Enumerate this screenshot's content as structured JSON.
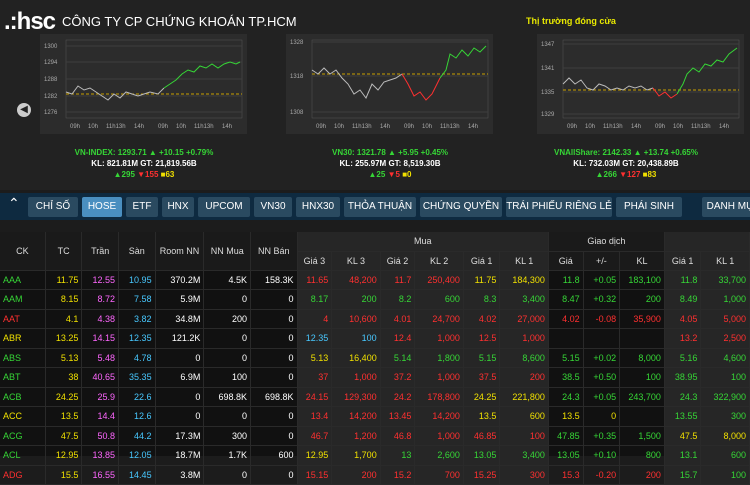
{
  "header": {
    "logo": ".:hsc",
    "company": "CÔNG TY CP CHỨNG KHOÁN TP.HCM",
    "market_status": "Thị trường đóng cửa"
  },
  "charts": [
    {
      "yticks": [
        "1300",
        "1294",
        "1288",
        "1282",
        "1276"
      ],
      "ref_label": "1282",
      "xticks": [
        "09h",
        "10h",
        "11h13h",
        "14h",
        "09h",
        "10h",
        "11h13h",
        "14h"
      ],
      "line1": "VN-INDEX: 1293.71 ▲ +10.15 +0.79%",
      "line2": "KL: 821.81M GT: 21,819.56B",
      "up": "▲295",
      "down": "▼155",
      "flat": "■63"
    },
    {
      "yticks": [
        "1328",
        "1318",
        "1308"
      ],
      "ref_label": "1318",
      "xticks": [
        "09h",
        "10h",
        "11h13h",
        "14h",
        "09h",
        "10h",
        "11h13h",
        "14h"
      ],
      "line1": "VN30: 1321.78 ▲ +5.95 +0.45%",
      "line2": "KL: 255.97M GT: 8,519.30B",
      "up": "▲25",
      "down": "▼5",
      "flat": "■0"
    },
    {
      "yticks": [
        "1347",
        "1341",
        "1335",
        "1329"
      ],
      "ref_label": "1335",
      "xticks": [
        "09h",
        "10h",
        "11h13h",
        "14h",
        "09h",
        "10h",
        "11h13h",
        "14h"
      ],
      "line1": "VNAllShare: 2142.33 ▲ +13.74 +0.65%",
      "line2": "KL: 732.03M GT: 20,438.89B",
      "up": "▲266",
      "down": "▼127",
      "flat": "■83"
    }
  ],
  "tabs": [
    "CHỈ SỐ",
    "HOSE",
    "ETF",
    "HNX",
    "UPCOM",
    "VN30",
    "HNX30",
    "THỎA THUẬN",
    "CHỨNG QUYỀN",
    "TRÁI PHIẾU RIÊNG LẺ",
    "PHÁI SINH",
    "DANH MỤ"
  ],
  "active_tab": "HOSE",
  "table": {
    "groups": {
      "mua": "Mua",
      "giao_dich": "Giao dịch"
    },
    "cols": [
      "CK",
      "TC",
      "Trần",
      "Sàn",
      "Room NN",
      "NN Mua",
      "NN Bán",
      "Giá 3",
      "KL 3",
      "Giá 2",
      "KL 2",
      "Giá 1",
      "KL 1",
      "Giá",
      "+/-",
      "KL",
      "Giá 1",
      "KL 1"
    ],
    "rows": [
      {
        "c": "up",
        "v": [
          "AAA",
          "11.75",
          "12.55",
          "10.95",
          "370.2M",
          "4.5K",
          "158.3K",
          "11.65",
          "48,200",
          "11.7",
          "250,400",
          "11.75",
          "184,300",
          "11.8",
          "+0.05",
          "183,100",
          "11.8",
          "33,700"
        ],
        "k": [
          "up",
          "ref",
          "ce",
          "fl",
          "wh",
          "wh",
          "wh",
          "dn",
          "dn",
          "dn",
          "dn",
          "ref",
          "ref",
          "up",
          "up",
          "up",
          "up",
          "up"
        ]
      },
      {
        "c": "up",
        "v": [
          "AAM",
          "8.15",
          "8.72",
          "7.58",
          "5.9M",
          "0",
          "0",
          "8.17",
          "200",
          "8.2",
          "600",
          "8.3",
          "3,400",
          "8.47",
          "+0.32",
          "200",
          "8.49",
          "1,000"
        ],
        "k": [
          "up",
          "ref",
          "ce",
          "fl",
          "wh",
          "wh",
          "wh",
          "up",
          "up",
          "up",
          "up",
          "up",
          "up",
          "up",
          "up",
          "up",
          "up",
          "up"
        ]
      },
      {
        "c": "dn",
        "v": [
          "AAT",
          "4.1",
          "4.38",
          "3.82",
          "34.8M",
          "200",
          "0",
          "4",
          "10,600",
          "4.01",
          "24,700",
          "4.02",
          "27,000",
          "4.02",
          "-0.08",
          "35,900",
          "4.05",
          "5,000"
        ],
        "k": [
          "dn",
          "ref",
          "ce",
          "fl",
          "wh",
          "wh",
          "wh",
          "dn",
          "dn",
          "dn",
          "dn",
          "dn",
          "dn",
          "dn",
          "dn",
          "dn",
          "dn",
          "dn"
        ]
      },
      {
        "c": "dn",
        "v": [
          "ABR",
          "13.25",
          "14.15",
          "12.35",
          "121.2K",
          "0",
          "0",
          "12.35",
          "100",
          "12.4",
          "1,000",
          "12.5",
          "1,000",
          "",
          "",
          "",
          "13.2",
          "2,500"
        ],
        "k": [
          "ref",
          "ref",
          "ce",
          "fl",
          "wh",
          "wh",
          "wh",
          "fl",
          "fl",
          "dn",
          "dn",
          "dn",
          "dn",
          "",
          "",
          "",
          "dn",
          "dn"
        ]
      },
      {
        "c": "up",
        "v": [
          "ABS",
          "5.13",
          "5.48",
          "4.78",
          "0",
          "0",
          "0",
          "5.13",
          "16,400",
          "5.14",
          "1,800",
          "5.15",
          "8,600",
          "5.15",
          "+0.02",
          "8,000",
          "5.16",
          "4,600"
        ],
        "k": [
          "up",
          "ref",
          "ce",
          "fl",
          "wh",
          "wh",
          "wh",
          "ref",
          "ref",
          "up",
          "up",
          "up",
          "up",
          "up",
          "up",
          "up",
          "up",
          "up"
        ]
      },
      {
        "c": "up",
        "v": [
          "ABT",
          "38",
          "40.65",
          "35.35",
          "6.9M",
          "100",
          "0",
          "37",
          "1,000",
          "37.2",
          "1,000",
          "37.5",
          "200",
          "38.5",
          "+0.50",
          "100",
          "38.95",
          "100"
        ],
        "k": [
          "up",
          "ref",
          "ce",
          "fl",
          "wh",
          "wh",
          "wh",
          "dn",
          "dn",
          "dn",
          "dn",
          "dn",
          "dn",
          "up",
          "up",
          "up",
          "up",
          "up"
        ]
      },
      {
        "c": "up",
        "v": [
          "ACB",
          "24.25",
          "25.9",
          "22.6",
          "0",
          "698.8K",
          "698.8K",
          "24.15",
          "129,300",
          "24.2",
          "178,800",
          "24.25",
          "221,800",
          "24.3",
          "+0.05",
          "243,700",
          "24.3",
          "322,900"
        ],
        "k": [
          "up",
          "ref",
          "ce",
          "fl",
          "wh",
          "wh",
          "wh",
          "dn",
          "dn",
          "dn",
          "dn",
          "ref",
          "ref",
          "up",
          "up",
          "up",
          "up",
          "up"
        ]
      },
      {
        "c": "ref",
        "v": [
          "ACC",
          "13.5",
          "14.4",
          "12.6",
          "0",
          "0",
          "0",
          "13.4",
          "14,200",
          "13.45",
          "14,200",
          "13.5",
          "600",
          "13.5",
          "0",
          "",
          "13.55",
          "300"
        ],
        "k": [
          "ref",
          "ref",
          "ce",
          "fl",
          "wh",
          "wh",
          "wh",
          "dn",
          "dn",
          "dn",
          "dn",
          "ref",
          "ref",
          "ref",
          "ref",
          "",
          "up",
          "up"
        ]
      },
      {
        "c": "up",
        "v": [
          "ACG",
          "47.5",
          "50.8",
          "44.2",
          "17.3M",
          "300",
          "0",
          "46.7",
          "1,200",
          "46.8",
          "1,000",
          "46.85",
          "100",
          "47.85",
          "+0.35",
          "1,500",
          "47.5",
          "8,000"
        ],
        "k": [
          "up",
          "ref",
          "ce",
          "fl",
          "wh",
          "wh",
          "wh",
          "dn",
          "dn",
          "dn",
          "dn",
          "dn",
          "dn",
          "up",
          "up",
          "up",
          "ref",
          "ref"
        ]
      },
      {
        "c": "up",
        "v": [
          "ACL",
          "12.95",
          "13.85",
          "12.05",
          "18.7M",
          "1.7K",
          "600",
          "12.95",
          "1,700",
          "13",
          "2,600",
          "13.05",
          "3,400",
          "13.05",
          "+0.10",
          "800",
          "13.1",
          "600"
        ],
        "k": [
          "up",
          "ref",
          "ce",
          "fl",
          "wh",
          "wh",
          "wh",
          "ref",
          "ref",
          "up",
          "up",
          "up",
          "up",
          "up",
          "up",
          "up",
          "up",
          "up"
        ]
      },
      {
        "c": "dn",
        "v": [
          "ADG",
          "15.5",
          "16.55",
          "14.45",
          "3.8M",
          "0",
          "0",
          "15.15",
          "200",
          "15.2",
          "700",
          "15.25",
          "300",
          "15.3",
          "-0.20",
          "200",
          "15.7",
          "100"
        ],
        "k": [
          "dn",
          "ref",
          "ce",
          "fl",
          "wh",
          "wh",
          "wh",
          "dn",
          "dn",
          "dn",
          "dn",
          "dn",
          "dn",
          "dn",
          "dn",
          "dn",
          "up",
          "up"
        ]
      }
    ]
  },
  "colors": {
    "up": "#36d636",
    "down": "#ff3030",
    "ref": "#f0e000",
    "ceil": "#ff66ff",
    "floor": "#48c8ff"
  }
}
